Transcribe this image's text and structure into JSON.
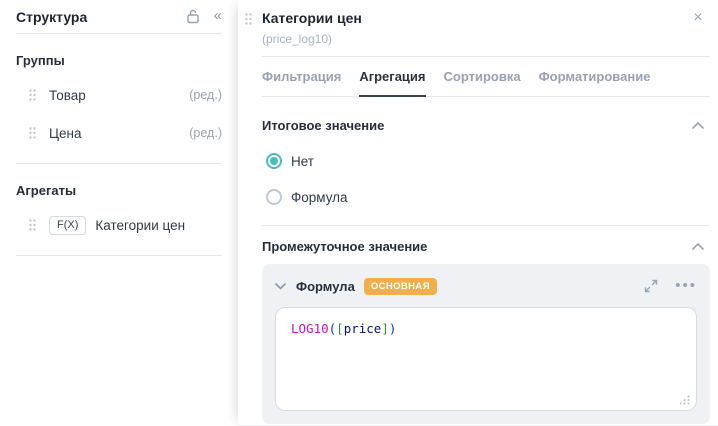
{
  "sidebar": {
    "title": "Структура",
    "groups_heading": "Группы",
    "groups": [
      {
        "label": "Товар",
        "edit": "(ред.)"
      },
      {
        "label": "Цена",
        "edit": "(ред.)"
      }
    ],
    "aggregates_heading": "Агрегаты",
    "aggregates": [
      {
        "badge": "F(X)",
        "label": "Категории цен"
      }
    ]
  },
  "panel": {
    "title": "Категории цен",
    "subtitle": "(price_log10)",
    "close_icon": "×",
    "tabs": [
      {
        "label": "Фильтрация"
      },
      {
        "label": "Агрегация"
      },
      {
        "label": "Сортировка"
      },
      {
        "label": "Форматирование"
      }
    ],
    "active_tab": "Агрегация",
    "total_section": {
      "heading": "Итоговое значение",
      "options": [
        {
          "label": "Нет",
          "selected": true
        },
        {
          "label": "Формула",
          "selected": false
        }
      ]
    },
    "intermediate_section": {
      "heading": "Промежуточное значение",
      "formula_label": "Формула",
      "badge": "ОСНОВНАЯ",
      "code_tokens": [
        {
          "text": "LOG10",
          "color": "#c913b9"
        },
        {
          "text": "(",
          "color": "#0431fa"
        },
        {
          "text": "[",
          "color": "#319331"
        },
        {
          "text": "price",
          "color": "#001080"
        },
        {
          "text": "]",
          "color": "#319331"
        },
        {
          "text": ")",
          "color": "#0431fa"
        }
      ]
    }
  },
  "colors": {
    "accent_teal": "#47bebe",
    "badge_orange": "#f0ae4d"
  }
}
